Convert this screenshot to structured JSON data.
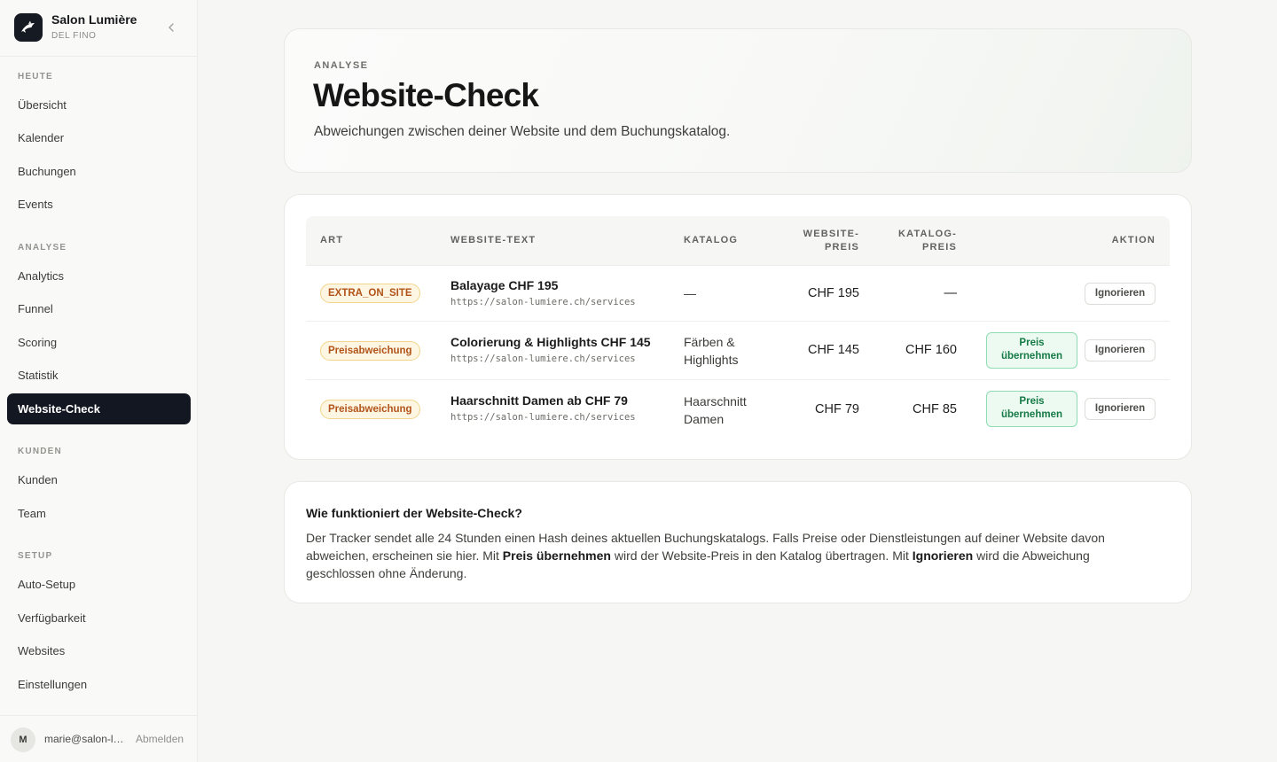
{
  "brand": {
    "name": "Salon Lumière",
    "subtitle": "DEL FINO"
  },
  "sidebar": {
    "sections": [
      {
        "label": "HEUTE",
        "items": [
          "Übersicht",
          "Kalender",
          "Buchungen",
          "Events"
        ]
      },
      {
        "label": "ANALYSE",
        "items": [
          "Analytics",
          "Funnel",
          "Scoring",
          "Statistik",
          "Website-Check"
        ]
      },
      {
        "label": "KUNDEN",
        "items": [
          "Kunden",
          "Team"
        ]
      },
      {
        "label": "SETUP",
        "items": [
          "Auto-Setup",
          "Verfügbarkeit",
          "Websites",
          "Einstellungen"
        ]
      }
    ],
    "active_item": "Website-Check"
  },
  "user": {
    "initial": "M",
    "email": "marie@salon-lumiere.ch",
    "logout_label": "Abmelden"
  },
  "hero": {
    "eyebrow": "ANALYSE",
    "title": "Website-Check",
    "subtitle": "Abweichungen zwischen deiner Website und dem Buchungskatalog."
  },
  "table": {
    "headers": {
      "art": "ART",
      "website_text": "WEBSITE-TEXT",
      "katalog": "KATALOG",
      "website_preis_1": "WEBSITE-",
      "website_preis_2": "PREIS",
      "katalog_preis_1": "KATALOG-",
      "katalog_preis_2": "PREIS",
      "aktion": "AKTION"
    },
    "accept_label_1": "Preis",
    "accept_label_2": "übernehmen",
    "ignore_label": "Ignorieren",
    "rows": [
      {
        "type": "EXTRA_ON_SITE",
        "title": "Balayage CHF 195",
        "url": "https://salon-lumiere.ch/services",
        "catalog_1": "—",
        "catalog_2": "",
        "website_price": "CHF 195",
        "catalog_price": "—",
        "has_accept": false
      },
      {
        "type": "Preisabweichung",
        "title": "Colorierung & Highlights CHF 145",
        "url": "https://salon-lumiere.ch/services",
        "catalog_1": "Färben &",
        "catalog_2": "Highlights",
        "website_price": "CHF 145",
        "catalog_price": "CHF 160",
        "has_accept": true
      },
      {
        "type": "Preisabweichung",
        "title": "Haarschnitt Damen ab CHF 79",
        "url": "https://salon-lumiere.ch/services",
        "catalog_1": "Haarschnitt",
        "catalog_2": "Damen",
        "website_price": "CHF 79",
        "catalog_price": "CHF 85",
        "has_accept": true
      }
    ]
  },
  "info": {
    "title": "Wie funktioniert der Website-Check?",
    "text_1": "Der Tracker sendet alle 24 Stunden einen Hash deines aktuellen Buchungskatalogs. Falls Preise oder Dienstleistungen auf deiner Website davon abweichen, erscheinen sie hier. Mit ",
    "bold_1": "Preis übernehmen",
    "text_2": " wird der Website-Preis in den Katalog übertragen. Mit ",
    "bold_2": "Ignorieren",
    "text_3": " wird die Abweichung geschlossen ohne Änderung."
  }
}
